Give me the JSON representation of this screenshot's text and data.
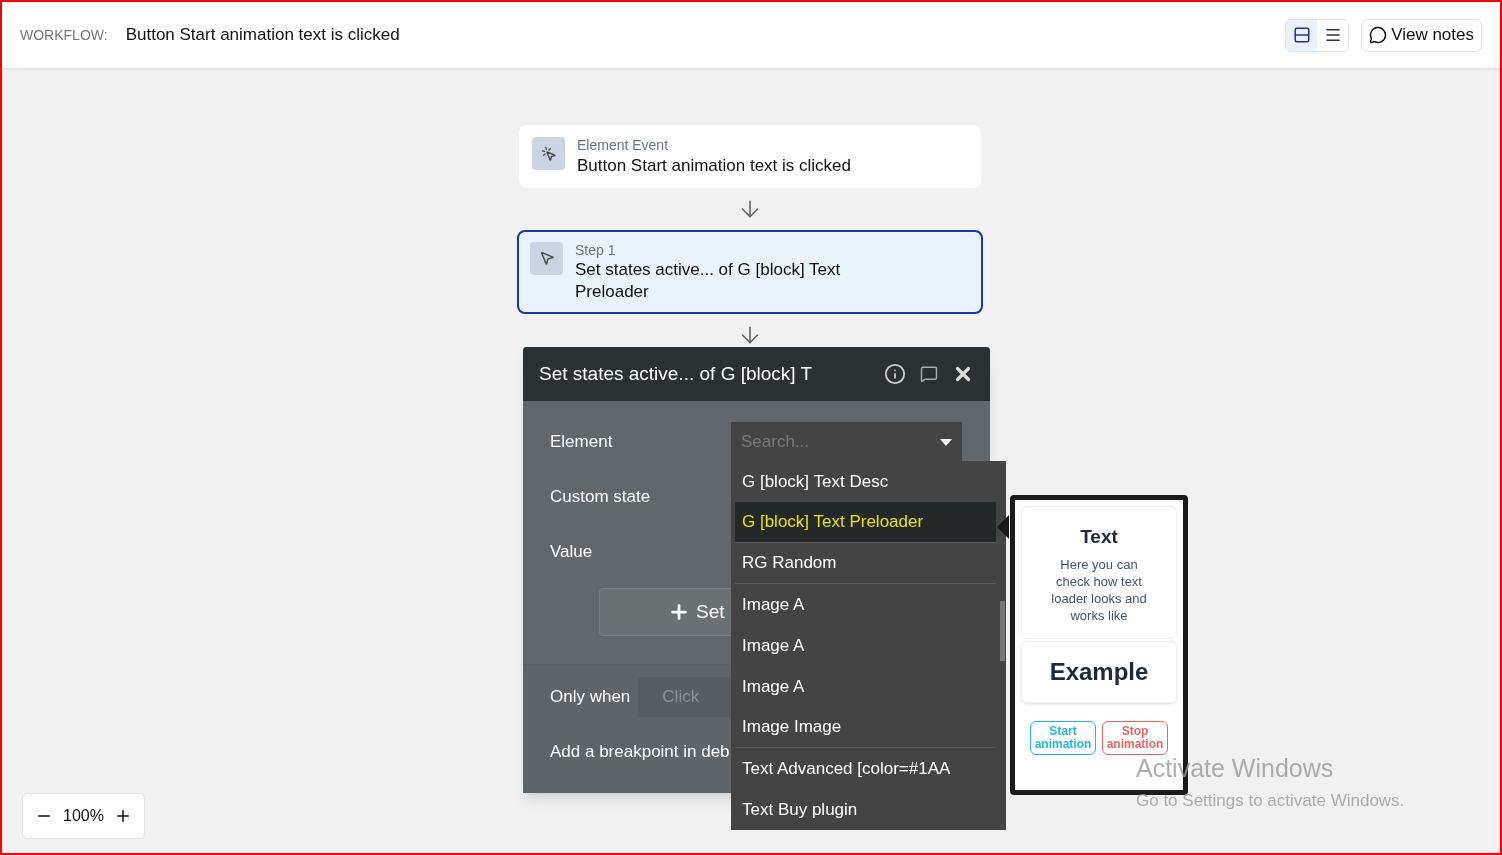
{
  "header": {
    "label": "WORKFLOW:",
    "title": "Button Start animation text is clicked",
    "view_toggle": [
      {
        "kind": "cards",
        "selected": true
      },
      {
        "kind": "list",
        "selected": false
      }
    ],
    "notes_button": "View notes"
  },
  "event_card": {
    "caption": "Element Event",
    "title": "Button Start animation text is clicked",
    "selected": false
  },
  "step_card": {
    "caption": "Step 1",
    "title": "Set states active... of G [block] Text Preloader",
    "selected": true
  },
  "editor": {
    "title": "Set states active... of G [block] T",
    "fields": [
      {
        "label": "Element"
      },
      {
        "label": "Custom state"
      },
      {
        "label": "Value"
      }
    ],
    "add_button": "Set",
    "only_when": {
      "label": "Only when",
      "placeholder": "Click"
    },
    "breakpoint": "Add a breakpoint in deb"
  },
  "dropdown": {
    "placeholder": "Search...",
    "items": [
      {
        "label": "G [block] Text Desc",
        "selected": false,
        "group_end": false
      },
      {
        "label": "G [block] Text Preloader",
        "selected": true,
        "group_end": true
      },
      {
        "label": "RG Random",
        "selected": false,
        "group_end": true
      },
      {
        "label": "Image A",
        "selected": false,
        "group_end": false
      },
      {
        "label": "Image A",
        "selected": false,
        "group_end": false
      },
      {
        "label": "Image A",
        "selected": false,
        "group_end": false
      },
      {
        "label": "Image Image",
        "selected": false,
        "group_end": true
      },
      {
        "label": "Text Advanced [color=#1AA",
        "selected": false,
        "group_end": false
      },
      {
        "label": "Text Buy plugin",
        "selected": false,
        "group_end": false
      }
    ]
  },
  "preview": {
    "title": "Text",
    "description": "Here you can check how text loader looks and works like",
    "example": "Example",
    "buttons": [
      {
        "label": "Start animation",
        "color": "#22b8d4"
      },
      {
        "label": "Stop animation",
        "color": "#f06262"
      }
    ]
  },
  "zoom": {
    "level": "100%"
  },
  "os_notice": {
    "title": "Activate Windows",
    "subtitle": "Go to Settings to activate Windows."
  }
}
